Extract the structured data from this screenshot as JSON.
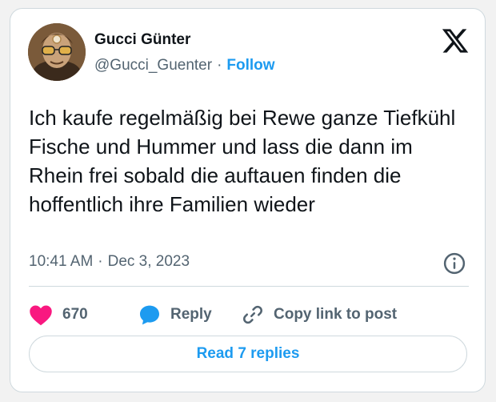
{
  "tweet": {
    "author_name": "Gucci Günter",
    "handle": "@Gucci_Guenter",
    "separator": "·",
    "follow_label": "Follow",
    "text": "Ich kaufe regelmäßig bei Rewe ganze Tiefkühl Fische und Hummer und lass die dann im Rhein frei sobald die auftauen finden die hoffentlich ihre Familien wieder",
    "time": "10:41 AM",
    "date": "Dec 3, 2023",
    "like_count": "670",
    "reply_label": "Reply",
    "copy_link_label": "Copy link to post",
    "read_replies_label": "Read 7 replies"
  },
  "icons": {
    "avatar": "avatar-photo",
    "brand": "x-logo-icon",
    "info": "info-icon",
    "like": "heart-icon",
    "reply": "speech-bubble-icon",
    "link": "link-icon"
  },
  "colors": {
    "accent": "#1d9bf0",
    "like": "#f91880",
    "text": "#0f1419",
    "secondary": "#536471",
    "border": "#cfd9de"
  }
}
